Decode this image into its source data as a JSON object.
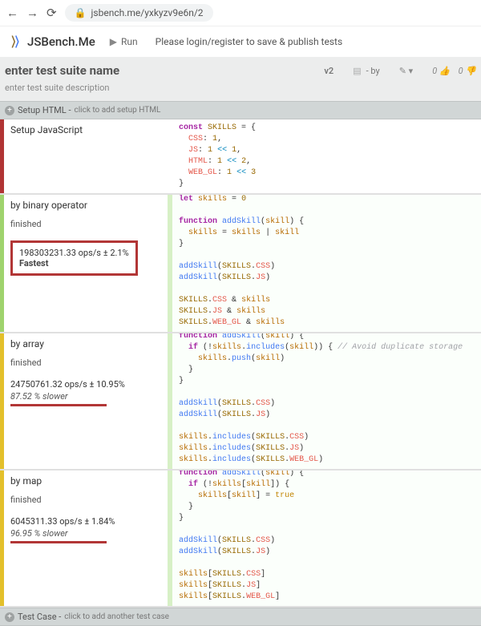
{
  "browser": {
    "url": "jsbench.me/yxkyzv9e6n/2"
  },
  "brand": "JSBench.Me",
  "run_label": "Run",
  "login_msg": "Please login/register to save & publish tests",
  "suite": {
    "title_placeholder": "enter test suite name",
    "version": "v2",
    "by": "- by",
    "desc_placeholder": "enter test suite description",
    "votes_up": "0",
    "votes_down": "0"
  },
  "setup_html": {
    "label": "Setup HTML -",
    "hint": "click to add setup HTML"
  },
  "setup_js_label": "Setup JavaScript",
  "tests": [
    {
      "name": "by binary operator",
      "status": "finished",
      "ops": "198303231.33 ops/s ± 2.1%",
      "tag": "Fastest"
    },
    {
      "name": "by array",
      "status": "finished",
      "ops": "24750761.32 ops/s ± 10.95%",
      "slower": "87.52 % slower"
    },
    {
      "name": "by map",
      "status": "finished",
      "ops": "6045311.33 ops/s ± 1.84%",
      "slower": "96.95 % slower"
    }
  ],
  "add_case": {
    "label": "Test Case -",
    "hint": "click to add another test case"
  }
}
